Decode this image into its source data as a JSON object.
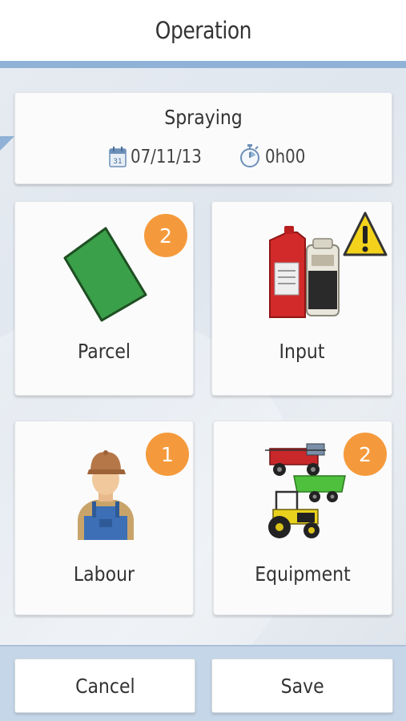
{
  "header": {
    "title": "Operation"
  },
  "operation": {
    "name": "Spraying",
    "date": "07/11/13",
    "duration": "0h00",
    "calendar_icon_text": "31"
  },
  "tiles": {
    "parcel": {
      "label": "Parcel",
      "badge": "2",
      "icon": "parcel-icon"
    },
    "input": {
      "label": "Input",
      "icon": "input-icon",
      "warning_icon": "warning-icon"
    },
    "labour": {
      "label": "Labour",
      "badge": "1",
      "icon": "labour-icon"
    },
    "equipment": {
      "label": "Equipment",
      "badge": "2",
      "icon": "equipment-icon"
    }
  },
  "footer": {
    "cancel_label": "Cancel",
    "save_label": "Save"
  },
  "colors": {
    "badge": "#f59a3c",
    "accent": "#8fb2d6",
    "footer_bg": "#c5d6e8",
    "parcel_green": "#3aa04a"
  }
}
